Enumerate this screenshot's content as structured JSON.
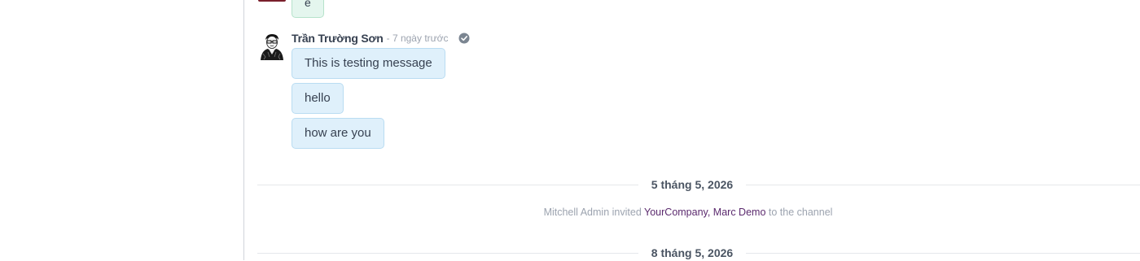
{
  "previous_message": {
    "text": "e"
  },
  "message_group": {
    "author": "Trần Trường Sơn",
    "timestamp": "- 7 ngày trước",
    "status_icon": "check-circle-icon",
    "messages": [
      "This is testing message",
      "hello",
      "how are you"
    ]
  },
  "separators": [
    "5 tháng 5, 2026",
    "8 tháng 5, 2026"
  ],
  "notification": {
    "actor": "Mitchell Admin",
    "verb": "invited",
    "targets": "YourCompany, Marc Demo",
    "suffix": "to the channel"
  },
  "colors": {
    "bubble_bg": "#dff0fb",
    "bubble_border": "#b9dcf2",
    "link": "#5b2a6e"
  }
}
